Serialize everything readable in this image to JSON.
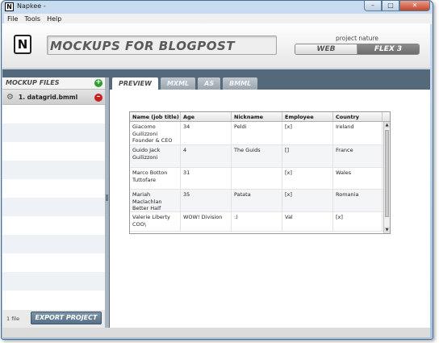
{
  "window": {
    "title": "Napkee -",
    "app_icon_letter": "N",
    "minimize": "–",
    "maximize": "□",
    "close": "✕"
  },
  "menu": [
    "File",
    "Tools",
    "Help"
  ],
  "header": {
    "logo_letter": "N",
    "project_title": "MOCKUPS FOR BLOGPOST",
    "nature_label": "project nature",
    "nature_options": [
      "WEB",
      "FLEX 3"
    ],
    "nature_selected": "FLEX 3"
  },
  "sidebar": {
    "title": "MOCKUP FILES",
    "add_icon": "+",
    "files": [
      {
        "name": "1. datagrid.bmml"
      }
    ],
    "gear_icon": "⚙",
    "remove_icon": "–",
    "file_count": "1 file",
    "export_label": "EXPORT PROJECT"
  },
  "tabs": [
    {
      "label": "PREVIEW",
      "active": true
    },
    {
      "label": "MXML",
      "active": false
    },
    {
      "label": "AS",
      "active": false
    },
    {
      "label": "BMML",
      "active": false
    }
  ],
  "datagrid": {
    "columns": [
      "Name (job title)",
      "Age",
      "Nickname",
      "Employee",
      "Country"
    ],
    "rows": [
      [
        "Giacomo Guilizzoni Founder & CEO",
        "34",
        "Peldi",
        "[x]",
        "Ireland"
      ],
      [
        "Guido Jack Guilizzoni",
        "4",
        "The Guids",
        "[]",
        "France"
      ],
      [
        "Marco Botton Tuttofare",
        "31",
        "",
        "[x]",
        "Wales"
      ],
      [
        "Mariah Maclachlan Better Half",
        "35",
        "Patata",
        "[x]",
        "Romania"
      ],
      [
        "Valerie Liberty COO\\",
        "WOW! Division",
        ":)",
        "Val",
        "[x]"
      ]
    ],
    "scroll_up": "▲",
    "scroll_down": "▼"
  },
  "colors": {
    "main_bg": "#54697a",
    "accent_add": "#2f9e2f",
    "accent_remove": "#c82020"
  }
}
